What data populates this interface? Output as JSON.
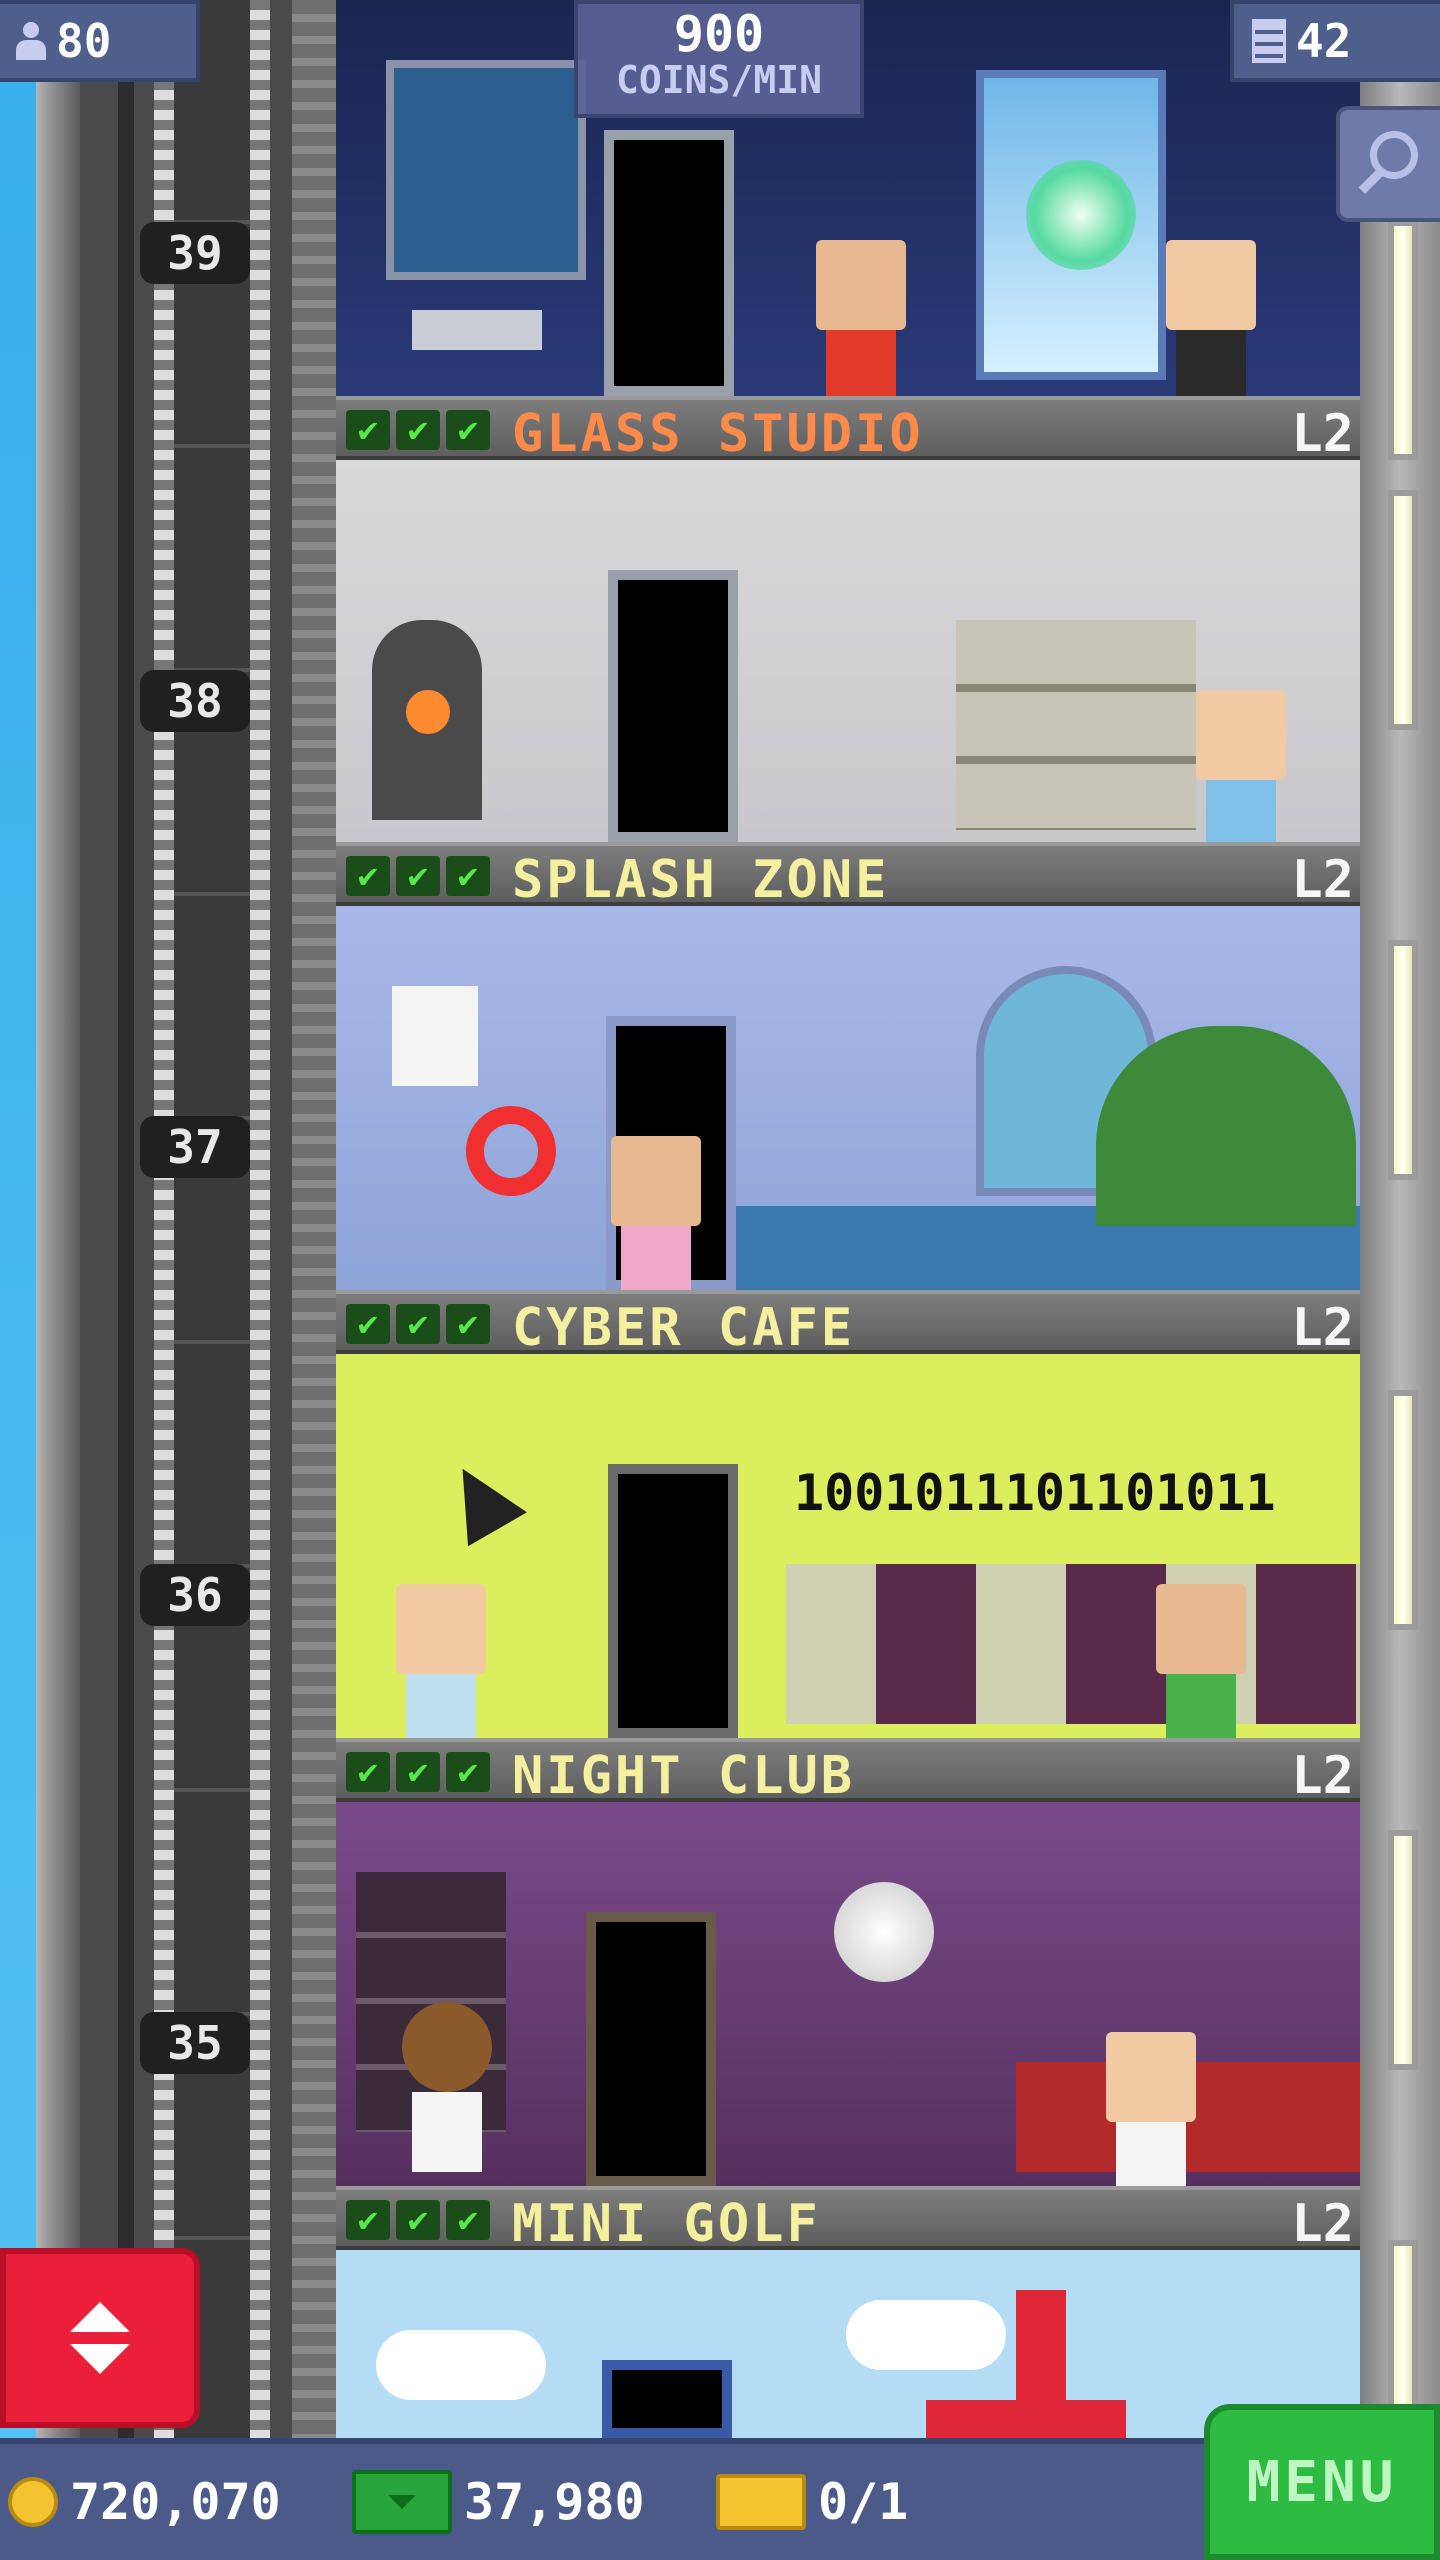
{
  "hud": {
    "population": "80",
    "population_icon": "person-icon",
    "coins_per_min_value": "900",
    "coins_per_min_label": "COINS/MIN",
    "floors_count": "42",
    "floors_icon": "building-icon",
    "zoom_icon": "magnifier-icon"
  },
  "elevator": {
    "floor_numbers": [
      "39",
      "38",
      "37",
      "36",
      "35"
    ],
    "button_icon": "up-down-arrows-icon"
  },
  "floors": [
    {
      "name": "GLASS STUDIO",
      "level": "L2",
      "checks": [
        "✔",
        "✔",
        "✔"
      ],
      "name_color": "#ff8a4a"
    },
    {
      "name": "SPLASH ZONE",
      "level": "L2",
      "checks": [
        "✔",
        "✔",
        "✔"
      ],
      "name_color": "#f4f0a0"
    },
    {
      "name": "CYBER CAFE",
      "level": "L2",
      "checks": [
        "✔",
        "✔",
        "✔"
      ],
      "name_color": "#f4f0a0"
    },
    {
      "name": "NIGHT CLUB",
      "level": "L2",
      "checks": [
        "✔",
        "✔",
        "✔"
      ],
      "name_color": "#f4f0a0"
    },
    {
      "name": "MINI GOLF",
      "level": "L2",
      "checks": [
        "✔",
        "✔",
        "✔"
      ],
      "name_color": "#f4f0a0"
    }
  ],
  "cyber_cafe_binary": "1001011101101011",
  "bottom_bar": {
    "coins": "720,070",
    "coins_icon": "coin-icon",
    "tower_bux": "37,980",
    "tower_bux_icon": "bux-icon",
    "tickets": "0/1",
    "tickets_icon": "ticket-icon",
    "menu_label": "MENU"
  },
  "colors": {
    "sky": "#3fb2ee",
    "hud_panel": "#4f5f8c",
    "menu_button": "#2dbb42",
    "elevator_button": "#ec1f3a",
    "check_green": "#57e84a"
  }
}
